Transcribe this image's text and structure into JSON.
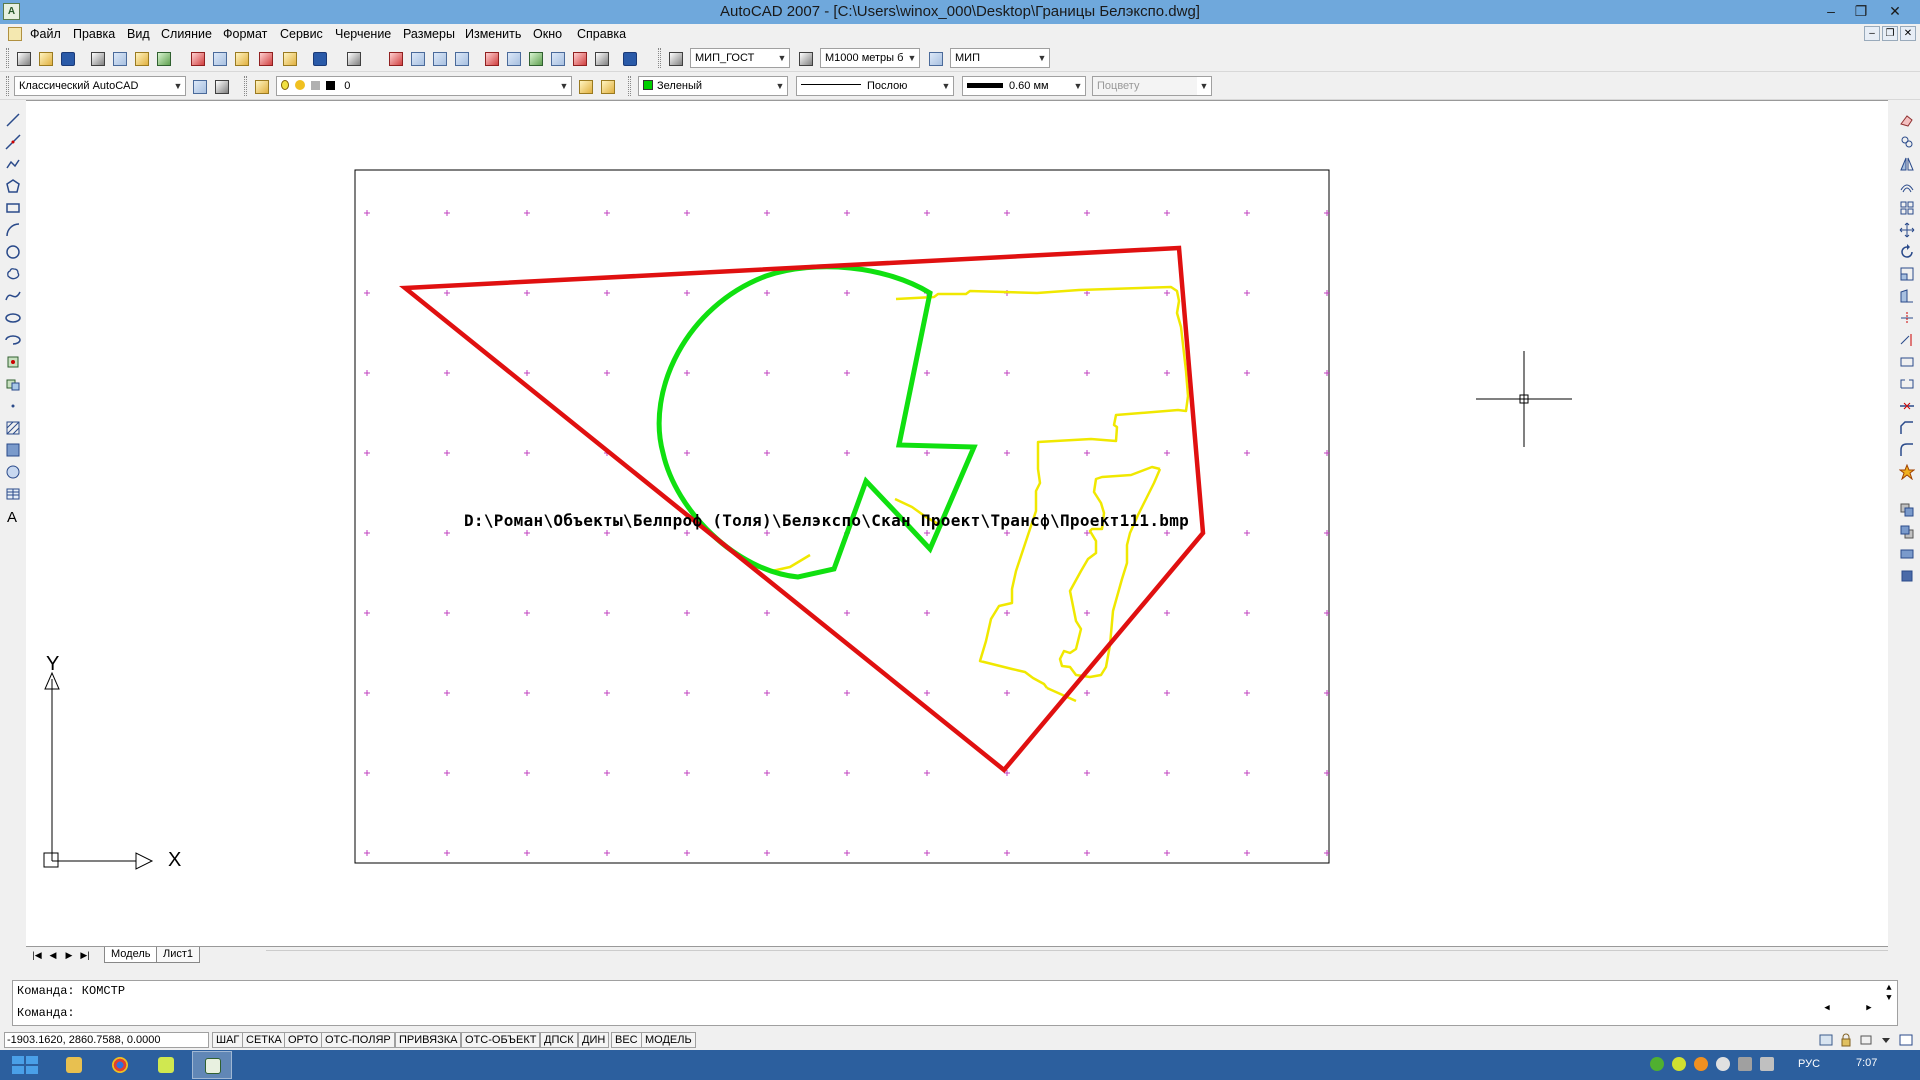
{
  "titlebar": {
    "title": "AutoCAD 2007 - [C:\\Users\\winox_000\\Desktop\\Границы Белэкспо.dwg]",
    "minimize": "–",
    "restore": "❐",
    "close": "✕"
  },
  "menubar": {
    "items": [
      "Файл",
      "Правка",
      "Вид",
      "Слияние",
      "Формат",
      "Сервис",
      "Черчение",
      "Размеры",
      "Изменить",
      "Окно",
      "Справка"
    ],
    "doc_minimize": "–",
    "doc_restore": "❐",
    "doc_close": "✕"
  },
  "toolbar1": {
    "text_style": "МИП_ГОСТ",
    "dim_style": "М1000 метры б",
    "table_style": "МИП"
  },
  "toolbar2": {
    "workspace": "Классический AutoCAD",
    "layer": "0",
    "color": "Зеленый",
    "color_hex": "#00c000",
    "linetype": "Послою",
    "lineweight": "0.60 мм",
    "plotstyle": "Поцвету"
  },
  "drawing": {
    "image_path_label": "D:\\Роман\\Объекты\\Белпроф (Толя)\\Белэкспо\\Скан Проект\\Трансф\\Проект111.bmp",
    "ucs_y": "Y",
    "ucs_x": "X",
    "colors": {
      "boundary": "#e01010",
      "green_zone": "#10e010",
      "yellow_zone": "#f0f000",
      "grid_marks": "#c040c0"
    }
  },
  "layout_tabs": {
    "nav": [
      "|◀",
      "◀",
      "▶",
      "▶|"
    ],
    "tabs": [
      "Модель",
      "Лист1"
    ]
  },
  "command": {
    "line1": "Команда: КОМСТР",
    "line2": "Команда:"
  },
  "statusbar": {
    "coords": "-1903.1620, 2860.7588, 0.0000",
    "buttons": [
      "ШАГ",
      "СЕТКА",
      "ОРТО",
      "ОТС-ПОЛЯР",
      "ПРИВЯЗКА",
      "ОТС-ОБЪЕКТ",
      "ДПСК",
      "ДИН",
      "ВЕС",
      "МОДЕЛЬ"
    ]
  },
  "taskbar": {
    "language": "РУС",
    "time": "7:07"
  }
}
